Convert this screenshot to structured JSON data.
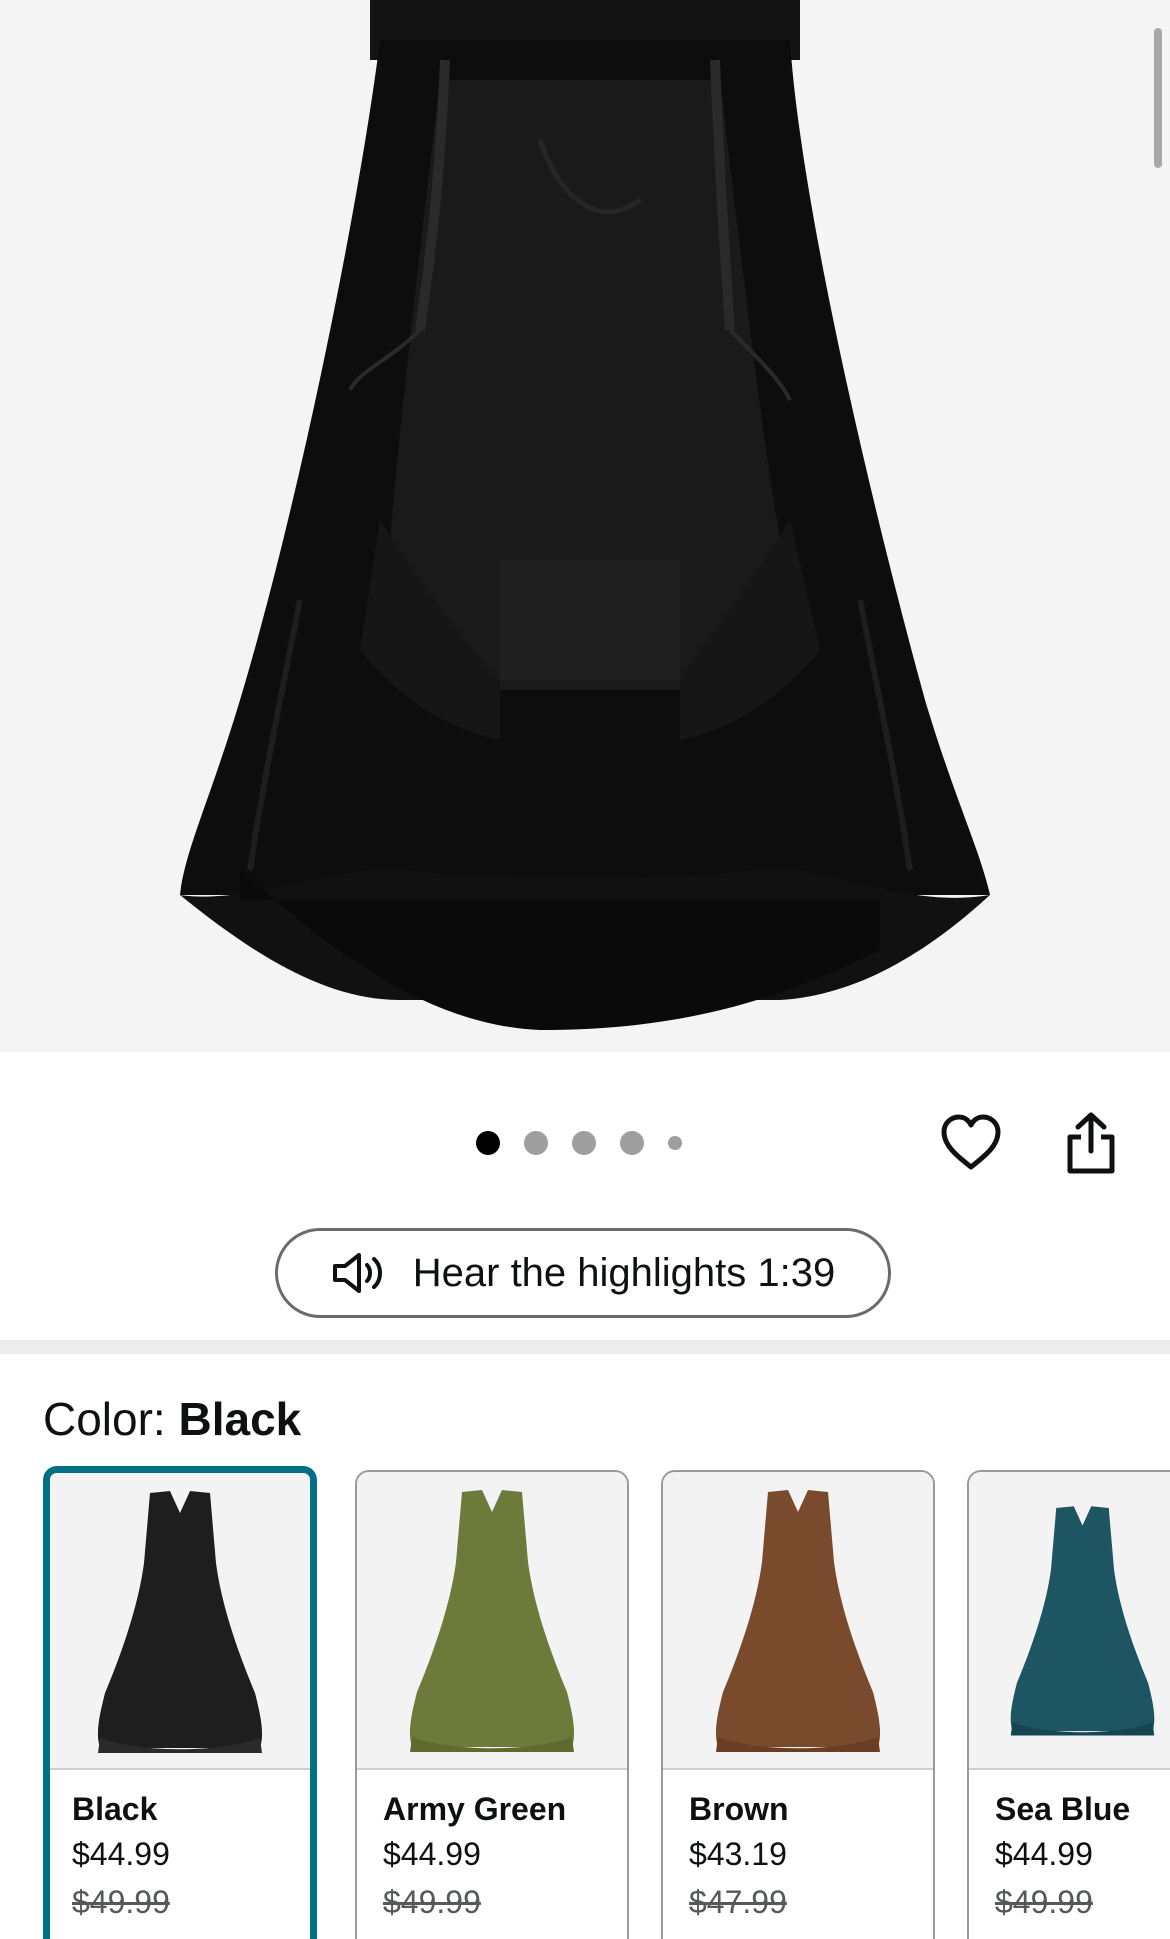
{
  "hero": {
    "image_label": "Black high-low ruffled skirt",
    "dots_total": 5,
    "active_dot": 0
  },
  "actions": {
    "favorite_icon": "heart-icon",
    "share_icon": "share-icon"
  },
  "audio": {
    "label": "Hear the highlights 1:39",
    "icon": "speaker-icon"
  },
  "color": {
    "prefix": "Color: ",
    "selected": "Black"
  },
  "swatches": [
    {
      "name": "Black",
      "price": "$44.99",
      "list_price": "$49.99",
      "color": "#1e1e1e",
      "selected": true
    },
    {
      "name": "Army Green",
      "price": "$44.99",
      "list_price": "$49.99",
      "color": "#6d7a3a",
      "selected": false
    },
    {
      "name": "Brown",
      "price": "$43.19",
      "list_price": "$47.99",
      "color": "#7a4a2c",
      "selected": false
    },
    {
      "name": "Sea Blue",
      "price": "$44.99",
      "list_price": "$49.99",
      "color": "#1d5563",
      "selected": false
    }
  ],
  "colors": {
    "accent": "#007185",
    "border": "#9a9a9a"
  }
}
